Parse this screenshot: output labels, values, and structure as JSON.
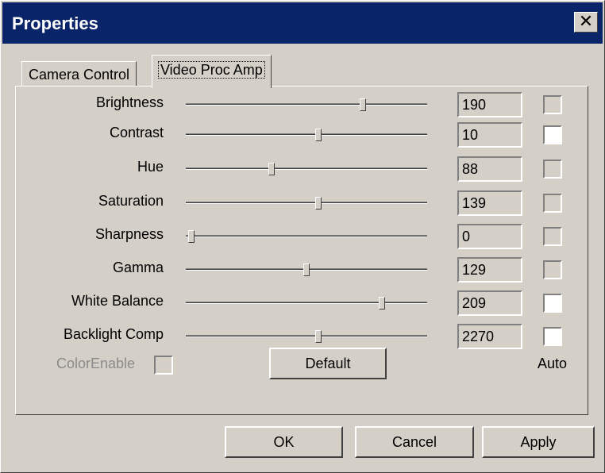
{
  "window": {
    "title": "Properties",
    "close_glyph": "✕"
  },
  "tabs": [
    {
      "label": "Camera Control",
      "active": false
    },
    {
      "label": "Video Proc Amp",
      "active": true
    }
  ],
  "settings": [
    {
      "label": "Brightness",
      "value": "190",
      "slider": 0.74,
      "auto": false
    },
    {
      "label": "Contrast",
      "value": "10",
      "slider": 0.55,
      "auto": true
    },
    {
      "label": "Hue",
      "value": "88",
      "slider": 0.35,
      "auto": false
    },
    {
      "label": "Saturation",
      "value": "139",
      "slider": 0.55,
      "auto": false
    },
    {
      "label": "Sharpness",
      "value": "0",
      "slider": 0.01,
      "auto": false
    },
    {
      "label": "Gamma",
      "value": "129",
      "slider": 0.5,
      "auto": false
    },
    {
      "label": "White Balance",
      "value": "209",
      "slider": 0.82,
      "auto": true
    },
    {
      "label": "Backlight Comp",
      "value": "2270",
      "slider": 0.55,
      "auto": true
    }
  ],
  "color_enable": {
    "label": "ColorEnable",
    "checked": false,
    "disabled": true
  },
  "default_button": "Default",
  "auto_label": "Auto",
  "footer": {
    "ok": "OK",
    "cancel": "Cancel",
    "apply": "Apply"
  },
  "colors": {
    "titlebar": "#0a246a",
    "face": "#d4d0c8"
  }
}
